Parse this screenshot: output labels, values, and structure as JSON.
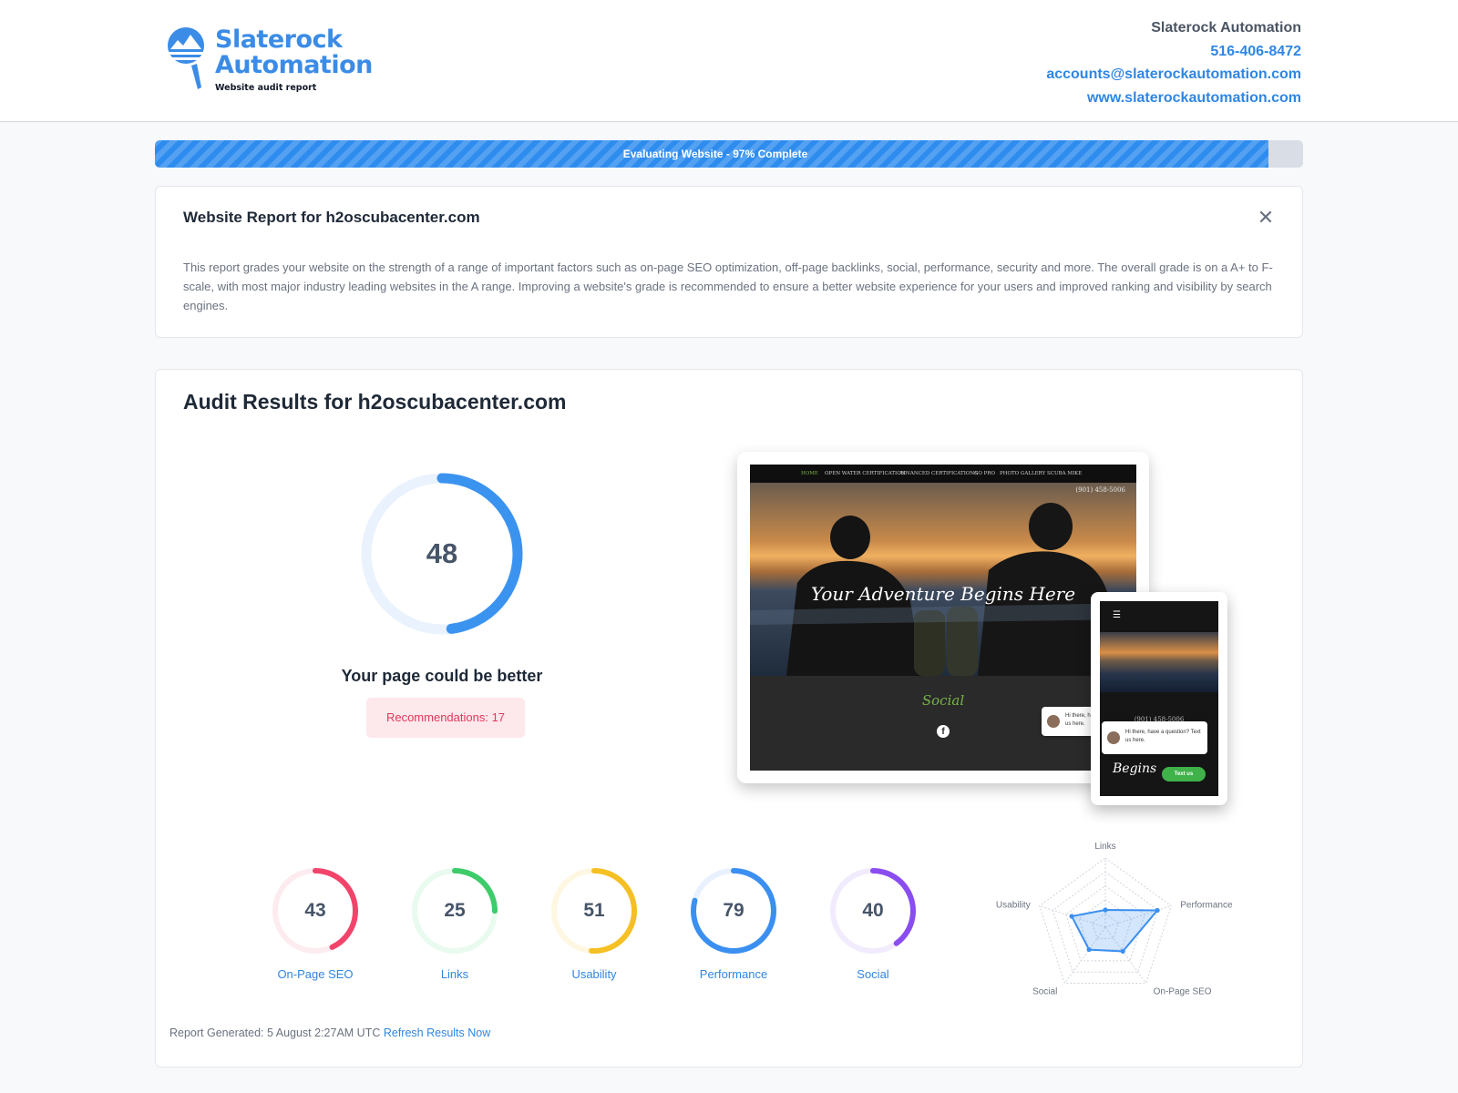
{
  "brand": {
    "name_line1": "Slaterock",
    "name_line2": "Automation",
    "tagline": "Website audit report",
    "color": "#3b8ce6"
  },
  "contact": {
    "company": "Slaterock Automation",
    "phone": "516-406-8472",
    "email": "accounts@slaterockautomation.com",
    "website": "www.slaterockautomation.com"
  },
  "progress": {
    "label": "Evaluating Website - 97% Complete",
    "fraction": 0.97,
    "color": "#2f8cef"
  },
  "intro": {
    "title": "Website Report for h2oscubacenter.com",
    "close_icon": "close-icon",
    "text": "This report grades your website on the strength of a range of important factors such as on-page SEO optimization, off-page backlinks, social, performance, security and more. The overall grade is on a A+ to F-scale, with most major industry leading websites in the A range. Improving a website's grade is recommended to ensure a better website experience for your users and improved ranking and visibility by search engines."
  },
  "audit": {
    "title": "Audit Results for h2oscubacenter.com",
    "overall_score": 48,
    "overall_color": "#3b93f0",
    "verdict": "Your page could be better",
    "recommendations": "Recommendations: 17",
    "scores": [
      {
        "label": "On-Page SEO",
        "value": 43,
        "color": "#f2446b",
        "track": "#fdecef"
      },
      {
        "label": "Links",
        "value": 25,
        "color": "#3ecb6a",
        "track": "#e9faee"
      },
      {
        "label": "Usability",
        "value": 51,
        "color": "#f5c023",
        "track": "#fef7e1"
      },
      {
        "label": "Performance",
        "value": 79,
        "color": "#3b8ff0",
        "track": "#e8f1fd"
      },
      {
        "label": "Social",
        "value": 40,
        "color": "#8a4df0",
        "track": "#f1ebfd"
      }
    ],
    "radar": {
      "axes": [
        "Links",
        "Performance",
        "On-Page SEO",
        "Social",
        "Usability"
      ],
      "values": [
        25,
        79,
        43,
        40,
        51
      ],
      "color": "#3b8ff0"
    },
    "footer": {
      "generated": "Report Generated: 5 August 2:27AM UTC",
      "refresh": "Refresh Results Now"
    }
  },
  "preview": {
    "nav": [
      "HOME",
      "OPEN WATER CERTIFICATION",
      "ADVANCED CERTIFICATIONS",
      "GO PRO",
      "PHOTO GALLERY",
      "SCUBA MIKE"
    ],
    "phone": "(901) 458-5006",
    "tagline": "Your Adventure Begins Here",
    "social_heading": "Social",
    "chat_text": "Hi there, have a question? Text us here.",
    "chat_button": "Text us",
    "mobile_tagline": "Begins"
  }
}
